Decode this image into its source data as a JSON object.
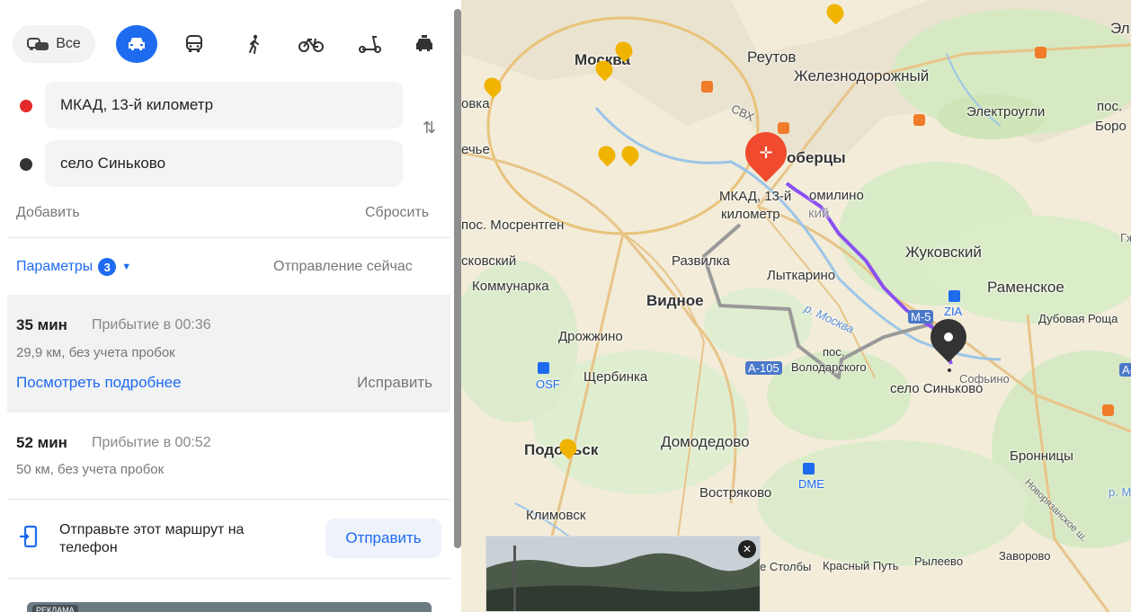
{
  "modes": {
    "all_label": "Все",
    "items": [
      "car-icon",
      "bus-icon",
      "walk-icon",
      "bike-icon",
      "scooter-icon",
      "taxi-icon"
    ]
  },
  "route": {
    "from_value": "МКАД, 13-й километр",
    "to_value": "село Синьково",
    "add_label": "Добавить",
    "reset_label": "Сбросить",
    "params_label": "Параметры",
    "params_count": "3",
    "depart_label": "Отправление сейчас"
  },
  "options": [
    {
      "time": "35 мин",
      "arrival": "Прибытие в 00:36",
      "distance": "29,9 км, без учета пробок",
      "details_label": "Посмотреть подробнее",
      "fix_label": "Исправить"
    },
    {
      "time": "52 мин",
      "arrival": "Прибытие в 00:52",
      "distance": "50 км, без учета пробок"
    }
  ],
  "send": {
    "text": "Отправьте этот маршрут на телефон",
    "button_label": "Отправить"
  },
  "ad": {
    "label": "РЕКЛАМА"
  },
  "map": {
    "places": {
      "moscow": "Москва",
      "reutov": "Реутов",
      "zheleznodorozhny": "Железнодорожный",
      "elektrougli": "Электроугли",
      "pos": "пос.",
      "boro": "Боро",
      "el": "Эл",
      "lyubertsy": "оберцы",
      "mkad_line1": "МКАД, 13-й",
      "mkad_line2": "километр",
      "tomilino": "омилино",
      "kiy": "кий",
      "mosrentgen": "пос. Мосрентген",
      "ovka": "овка",
      "rechye": "ечье",
      "skovsky": "сковский",
      "kommunarka": "Коммунарка",
      "razvilka": "Развилка",
      "lytkarino": "Лыткарино",
      "zhukovsky": "Жуковский",
      "ramenskoye": "Раменское",
      "dubovaya": "Дубовая Роща",
      "vidnoye": "Видное",
      "drozhzhino": "Дрожжино",
      "shcherbinka": "Щербинка",
      "volodarsky_1": "пос.",
      "volodarsky_2": "Володарского",
      "sofino": "Софьино",
      "sinkovo": "село Синьково",
      "podolsk": "Подольск",
      "domodedovo": "Домодедово",
      "bronnitsy": "Бронницы",
      "vostryakovo": "Востряково",
      "klimovsk": "Климовск",
      "stolby": "е Столбы",
      "krasny_put": "Красный Путь",
      "ryleevo": "Рылеево",
      "zavorovo": "Заворово",
      "osf": "OSF",
      "dme": "DME",
      "zia": "ZIA",
      "m5": "M-5",
      "a105": "A-105",
      "a1": "A-1",
      "moskva_river": "р. Москва",
      "svkh": "СВХ",
      "gzh": "Гж",
      "novoryazanskoye": "Новорязанское ш.",
      "rm": "р. М"
    }
  }
}
